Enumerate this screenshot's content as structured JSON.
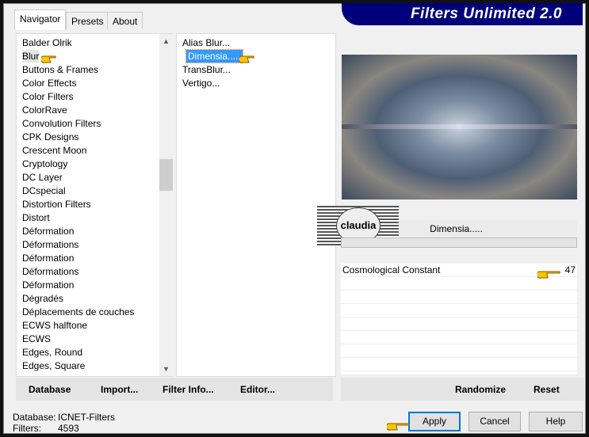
{
  "title": "Filters Unlimited 2.0",
  "tabs": [
    {
      "label": "Navigator",
      "active": true
    },
    {
      "label": "Presets"
    },
    {
      "label": "About"
    }
  ],
  "categories": [
    "Balder Olrik",
    "Blur",
    "Buttons & Frames",
    "Color Effects",
    "Color Filters",
    "ColorRave",
    "Convolution Filters",
    "CPK Designs",
    "Crescent Moon",
    "Cryptology",
    "DC Layer",
    "DCspecial",
    "Distortion Filters",
    "Distort",
    "Déformation",
    "Déformations",
    "Déformation",
    "Déformations",
    "Déformation",
    "Dégradés",
    "Déplacements de couches",
    "ECWS halftone",
    "ECWS",
    "Edges, Round",
    "Edges, Square"
  ],
  "selected_category": "Blur",
  "filters": [
    "Alias Blur...",
    "Dimensia.....",
    "TransBlur...",
    "Vertigo..."
  ],
  "selected_filter": "Dimensia.....",
  "preview": {
    "filter_name": "Dimensia.....",
    "watermark": "claudia"
  },
  "parameters": [
    {
      "label": "Cosmological Constant",
      "value": "47"
    }
  ],
  "left_buttons": {
    "database": "Database",
    "import": "Import...",
    "filter_info": "Filter Info...",
    "editor": "Editor..."
  },
  "right_buttons": {
    "randomize": "Randomize",
    "reset": "Reset"
  },
  "status": {
    "database_label": "Database:",
    "database_value": "ICNET-Filters",
    "filters_label": "Filters:",
    "filters_value": "4593"
  },
  "dialog_buttons": {
    "apply": "Apply",
    "cancel": "Cancel",
    "help": "Help"
  },
  "colors": {
    "banner": "#00007a",
    "selection": "#3399ff"
  }
}
